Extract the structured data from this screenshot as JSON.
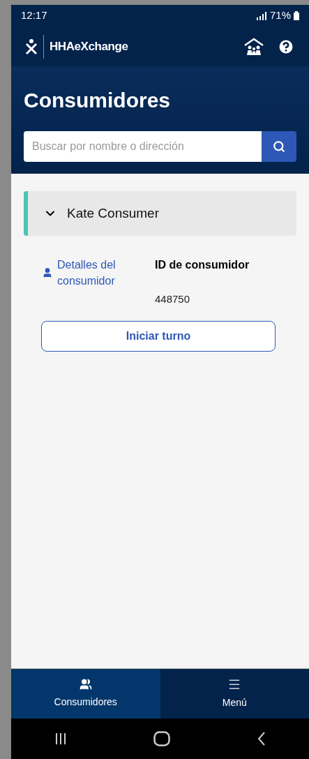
{
  "status_bar": {
    "time": "12:17",
    "battery": "71%"
  },
  "header": {
    "logo": "HHAeXchange"
  },
  "title": "Consumidores",
  "search": {
    "placeholder": "Buscar por nombre o dirección"
  },
  "consumers": [
    {
      "name": "Kate Consumer",
      "expanded": true,
      "details_link": "Detalles del consumidor",
      "id_label": "ID de consumidor",
      "id_value": "448750",
      "action": "Iniciar turno"
    }
  ],
  "bottom_nav": [
    {
      "label": "Consumidores",
      "kind": "people",
      "selected": true
    },
    {
      "label": "Menú",
      "kind": "menu",
      "selected": false
    }
  ]
}
